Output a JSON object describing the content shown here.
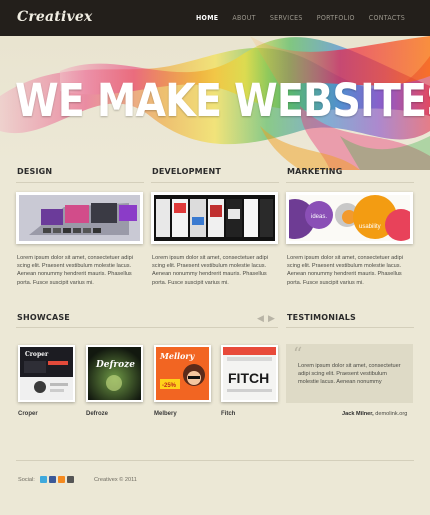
{
  "brand": {
    "logo": "Creativex"
  },
  "nav": {
    "items": [
      "HOME",
      "ABOUT",
      "SERVICES",
      "PORTFOLIO",
      "CONTACTS"
    ],
    "active": "HOME"
  },
  "hero": {
    "title": "WE MAKE WEBSITES."
  },
  "services": [
    {
      "heading": "DESIGN",
      "text": "Lorem ipsum dolor sit amet, consectetuer adipi scing elit. Praesent vestibulum molestie lacus. Aenean nonummy hendrerit mauris. Phasellus porta. Fusce suscipit varius mi."
    },
    {
      "heading": "DEVELOPMENT",
      "text": "Lorem ipsum dolor sit amet, consectetuer adipi scing elit. Praesent vestibulum molestie lacus. Aenean nonummy hendrerit mauris. Phasellus porta. Fusce suscipit varius mi."
    },
    {
      "heading": "MARKETING",
      "text": "Lorem ipsum dolor sit amet, consectetuer adipi scing elit. Praesent vestibulum molestie lacus. Aenean nonummy hendrerit mauris. Phasellus porta. Fusce suscipit varius mi."
    }
  ],
  "thumb_text": {
    "marketing_ideas": "ideas.",
    "marketing_usability": "usability"
  },
  "showcase": {
    "heading": "SHOWCASE",
    "items": [
      {
        "caption": "Croper",
        "art": "Croper"
      },
      {
        "caption": "Defroze",
        "art": "Defroze"
      },
      {
        "caption": "Melbery",
        "art": "Mellory",
        "badge": "-25%"
      },
      {
        "caption": "Fitch",
        "art": "FITCH"
      }
    ]
  },
  "testimonials": {
    "heading": "TESTIMONIALS",
    "quote": "Lorem ipsum dolor sit amet, consectetuer adipi scing elit. Praesent vestibulum molestie lacus. Aenean nonummy",
    "author": "Jack Milner,",
    "site": "demolink.org"
  },
  "footer": {
    "social_label": "Social:",
    "copyright": "Creativex © 2011"
  },
  "colors": {
    "topbar": "#231f1b",
    "page_bg": "#ece8d6",
    "accent_orange": "#f26522"
  }
}
